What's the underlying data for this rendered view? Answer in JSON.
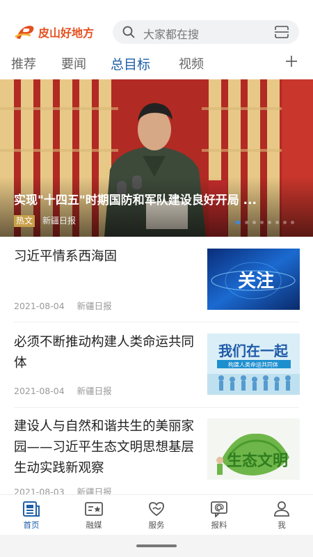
{
  "app": {
    "logo_text": "皮山好地方",
    "brand_color": "#e4501f",
    "accent_color": "#1f5fa7"
  },
  "search": {
    "placeholder": "大家都在搜",
    "icon": "search-icon",
    "scan_icon": "scan-icon"
  },
  "tabs": [
    {
      "label": "推荐",
      "active": false
    },
    {
      "label": "要闻",
      "active": false
    },
    {
      "label": "总目标",
      "active": true
    },
    {
      "label": "视频",
      "active": false
    }
  ],
  "tab_add_icon": "plus-icon",
  "banner": {
    "title": "实现\"十四五\"时期国防和军队建设良好开局 ...",
    "tag": "热文",
    "source": "新疆日报",
    "slide_count": 8,
    "active_slide": 1
  },
  "news": [
    {
      "title": "习近平情系西海固",
      "date": "2021-08-04",
      "source": "新疆日报",
      "thumb_text": "关注"
    },
    {
      "title": "必须不断推动构建人类命运共同体",
      "date": "2021-08-04",
      "source": "新疆日报",
      "thumb_text": "我们在一起",
      "thumb_subtext": "构建人类命运共同体"
    },
    {
      "title": "建设人与自然和谐共生的美丽家园——习近平生态文明思想基层生动实践新观察",
      "date": "2021-08-03",
      "source": "新疆日报",
      "thumb_text": "生态文明"
    }
  ],
  "bottom_nav": [
    {
      "label": "首页",
      "icon": "news-icon",
      "active": true
    },
    {
      "label": "融媒",
      "icon": "media-icon",
      "active": false
    },
    {
      "label": "服务",
      "icon": "heart-service-icon",
      "active": false
    },
    {
      "label": "报料",
      "icon": "report-icon",
      "active": false
    },
    {
      "label": "我",
      "icon": "user-icon",
      "active": false
    }
  ]
}
